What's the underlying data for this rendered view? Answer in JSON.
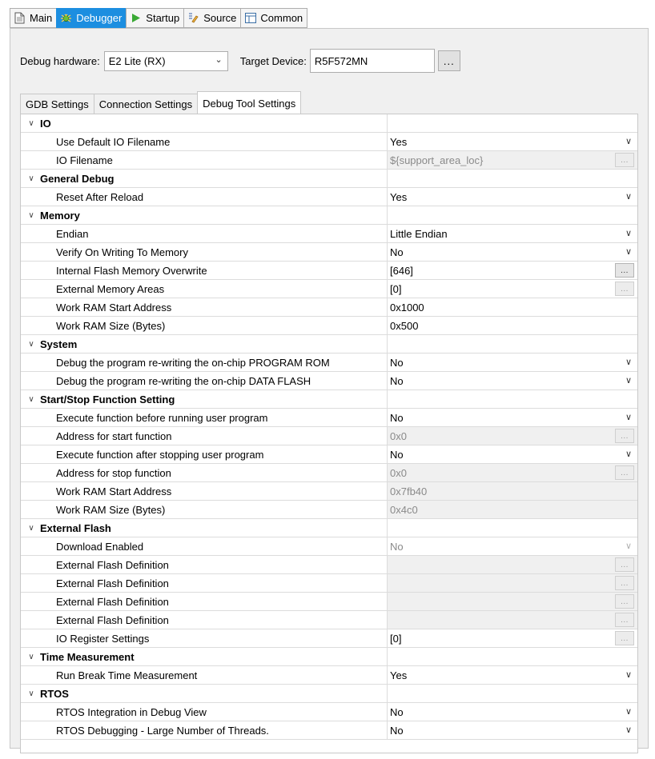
{
  "tabs": [
    {
      "label": "Main",
      "icon": "document-icon",
      "active": false
    },
    {
      "label": "Debugger",
      "icon": "debugger-icon",
      "active": true
    },
    {
      "label": "Startup",
      "icon": "play-icon",
      "active": false
    },
    {
      "label": "Source",
      "icon": "source-icon",
      "active": false
    },
    {
      "label": "Common",
      "icon": "common-icon",
      "active": false
    }
  ],
  "debug_hardware": {
    "label": "Debug hardware:",
    "value": "E2 Lite (RX)"
  },
  "target_device": {
    "label": "Target Device:",
    "value": "R5F572MN",
    "browse_label": "..."
  },
  "sub_tabs": [
    {
      "label": "GDB Settings",
      "active": false
    },
    {
      "label": "Connection Settings",
      "active": false
    },
    {
      "label": "Debug Tool Settings",
      "active": true
    }
  ],
  "tree": [
    {
      "type": "category",
      "label": "IO"
    },
    {
      "type": "prop",
      "label": "Use Default IO Filename",
      "value": "Yes",
      "control": "dropdown"
    },
    {
      "type": "prop",
      "label": "IO Filename",
      "value": "${support_area_loc}",
      "control": "browse",
      "disabled": true
    },
    {
      "type": "category",
      "label": "General Debug"
    },
    {
      "type": "prop",
      "label": "Reset After Reload",
      "value": "Yes",
      "control": "dropdown"
    },
    {
      "type": "category",
      "label": "Memory"
    },
    {
      "type": "prop",
      "label": "Endian",
      "value": "Little Endian",
      "control": "dropdown"
    },
    {
      "type": "prop",
      "label": "Verify On Writing To Memory",
      "value": "No",
      "control": "dropdown"
    },
    {
      "type": "prop",
      "label": "Internal Flash Memory Overwrite",
      "value": "[646]",
      "control": "browse"
    },
    {
      "type": "prop",
      "label": "External Memory Areas",
      "value": "[0]",
      "control": "browse-dim"
    },
    {
      "type": "prop",
      "label": "Work RAM Start Address",
      "value": "0x1000",
      "control": "none"
    },
    {
      "type": "prop",
      "label": "Work RAM Size (Bytes)",
      "value": "0x500",
      "control": "none"
    },
    {
      "type": "category",
      "label": "System"
    },
    {
      "type": "prop",
      "label": "Debug the program re-writing the on-chip PROGRAM ROM",
      "value": "No",
      "control": "dropdown"
    },
    {
      "type": "prop",
      "label": "Debug the program re-writing the on-chip DATA FLASH",
      "value": "No",
      "control": "dropdown"
    },
    {
      "type": "category",
      "label": "Start/Stop Function Setting"
    },
    {
      "type": "prop",
      "label": "Execute function before running user program",
      "value": "No",
      "control": "dropdown"
    },
    {
      "type": "prop",
      "label": "Address for start function",
      "value": "0x0",
      "control": "browse",
      "disabled": true
    },
    {
      "type": "prop",
      "label": "Execute function after stopping user program",
      "value": "No",
      "control": "dropdown"
    },
    {
      "type": "prop",
      "label": "Address for stop function",
      "value": "0x0",
      "control": "browse",
      "disabled": true
    },
    {
      "type": "prop",
      "label": "Work RAM Start Address",
      "value": "0x7fb40",
      "control": "none",
      "disabled": true
    },
    {
      "type": "prop",
      "label": "Work RAM Size (Bytes)",
      "value": "0x4c0",
      "control": "none",
      "disabled": true
    },
    {
      "type": "category",
      "label": "External Flash"
    },
    {
      "type": "prop",
      "label": "Download Enabled",
      "value": "No",
      "control": "dropdown",
      "disabled": true,
      "plain": true
    },
    {
      "type": "prop",
      "label": "External Flash Definition",
      "value": "",
      "control": "browse",
      "disabled": true
    },
    {
      "type": "prop",
      "label": "External Flash Definition",
      "value": "",
      "control": "browse",
      "disabled": true
    },
    {
      "type": "prop",
      "label": "External Flash Definition",
      "value": "",
      "control": "browse",
      "disabled": true
    },
    {
      "type": "prop",
      "label": "External Flash Definition",
      "value": "",
      "control": "browse",
      "disabled": true
    },
    {
      "type": "prop",
      "label": "IO Register Settings",
      "value": "[0]",
      "control": "browse-dim"
    },
    {
      "type": "category",
      "label": "Time Measurement"
    },
    {
      "type": "prop",
      "label": "Run Break Time Measurement",
      "value": "Yes",
      "control": "dropdown"
    },
    {
      "type": "category",
      "label": "RTOS"
    },
    {
      "type": "prop",
      "label": "RTOS Integration in Debug View",
      "value": "No",
      "control": "dropdown"
    },
    {
      "type": "prop",
      "label": "RTOS Debugging - Large Number of Threads.",
      "value": "No",
      "control": "dropdown"
    }
  ]
}
